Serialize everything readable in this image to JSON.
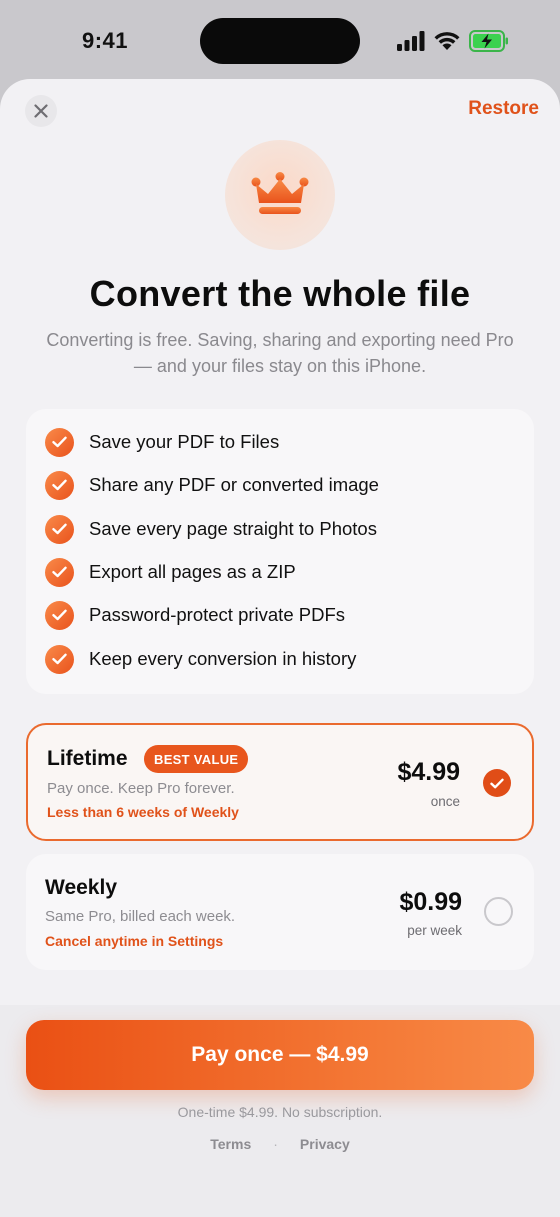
{
  "status_bar": {
    "time": "9:41",
    "icons": [
      "cellular-signal-icon",
      "wifi-icon",
      "battery-charging-icon"
    ]
  },
  "header": {
    "close_icon": "close-icon",
    "restore_label": "Restore"
  },
  "hero": {
    "icon": "crown-icon",
    "title": "Convert the whole file",
    "subtitle": "Converting is free. Saving, sharing and exporting need Pro — and your files stay on this iPhone."
  },
  "features": [
    {
      "label": "Save your PDF to Files"
    },
    {
      "label": "Share any PDF or converted image"
    },
    {
      "label": "Save every page straight to Photos"
    },
    {
      "label": "Export all pages as a ZIP"
    },
    {
      "label": "Password-protect private PDFs"
    },
    {
      "label": "Keep every conversion in history"
    }
  ],
  "plans": [
    {
      "name": "Lifetime",
      "badge": "BEST VALUE",
      "description": "Pay once. Keep Pro forever.",
      "note": "Less than 6 weeks of Weekly",
      "price": "$4.99",
      "period": "once",
      "selected": true
    },
    {
      "name": "Weekly",
      "description": "Same Pro, billed each week.",
      "note": "Cancel anytime in Settings",
      "price": "$0.99",
      "period": "per week",
      "selected": false
    }
  ],
  "footer": {
    "cta_label": "Pay once — $4.99",
    "fineprint": "One-time $4.99. No subscription.",
    "terms_label": "Terms",
    "separator": "·",
    "privacy_label": "Privacy"
  },
  "colors": {
    "accent": "#E8561D",
    "background": "#F2F1F4",
    "card": "#F8F7F9"
  }
}
